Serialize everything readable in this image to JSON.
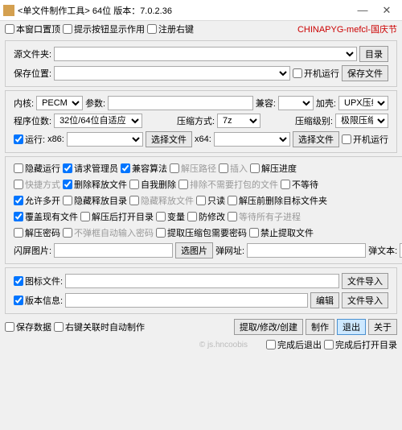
{
  "title": "<单文件制作工具> 64位 版本：7.0.2.36",
  "top": {
    "c1": "本窗口置顶",
    "c2": "提示按钮显示作用",
    "c3": "注册右键",
    "brand": "CHINAPYG-mefcl-国庆节"
  },
  "g1": {
    "src": "源文件夹:",
    "srcbtn": "目录",
    "dst": "保存位置:",
    "dstbtn": "保存文件",
    "boot": "开机运行"
  },
  "g2": {
    "kernel": "内核:",
    "kernelv": "PECMD",
    "param": "参数:",
    "compat": "兼容:",
    "shell": "加壳:",
    "shellv": "UPX压缩",
    "bits": "程序位数:",
    "bitsv": "32位/64位自适应",
    "zmode": "压缩方式:",
    "zmodev": "7z",
    "zlvl": "压缩级别:",
    "zlvlv": "极限压缩",
    "run": "运行:",
    "x86": "x86:",
    "pick": "选择文件",
    "x64": "x64:",
    "bootrun": "开机运行"
  },
  "g3": {
    "c1": "隐藏运行",
    "c2": "请求管理员",
    "c3": "兼容算法",
    "c4": "解压路径",
    "c5": "插入",
    "c6": "解压进度",
    "c7": "快捷方式",
    "c8": "删除释放文件",
    "c9": "自我删除",
    "c10": "排除不需要打包的文件",
    "c11": "不等待",
    "c12": "允许多开",
    "c13": "隐藏释放目录",
    "c14": "隐藏释放文件",
    "c15": "只读",
    "c16": "解压前删除目标文件夹",
    "c17": "覆盖现有文件",
    "c18": "解压后打开目录",
    "c19": "变量",
    "c20": "防修改",
    "c21": "等待所有子进程",
    "c22": "解压密码",
    "c23": "不弹框自动输入密码",
    "c24": "提取压缩包需要密码",
    "c25": "禁止提取文件",
    "flash": "闪屏图片:",
    "flashbtn": "选图片",
    "popurl": "弹网址:",
    "poptxt": "弹文本:"
  },
  "g4": {
    "ico": "图标文件:",
    "ver": "版本信息:",
    "imp": "文件导入",
    "edit": "编辑"
  },
  "bot": {
    "c1": "保存数据",
    "c2": "右键关联时自动制作",
    "b1": "提取/修改/创建",
    "b2": "制作",
    "b3": "退出",
    "b4": "关于",
    "c3": "完成后退出",
    "c4": "完成后打开目录",
    "wm": "© js.hncoobis"
  }
}
